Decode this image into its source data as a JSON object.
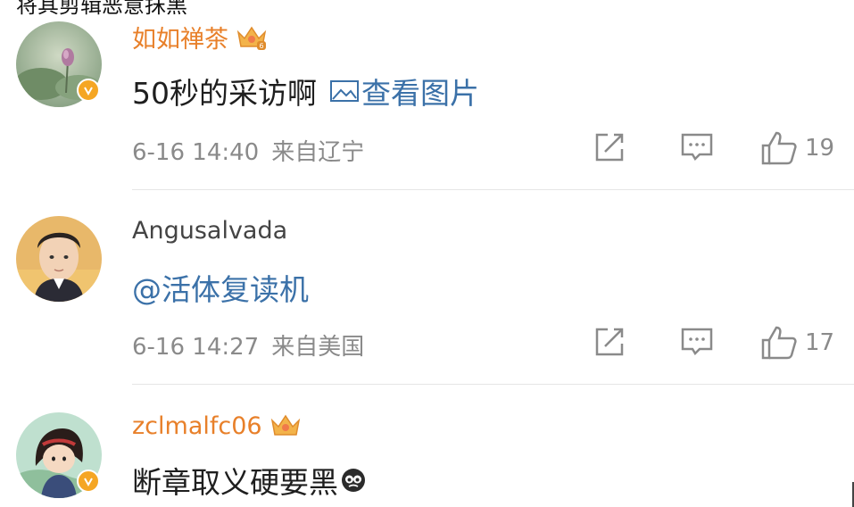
{
  "top_partial_text": "将其剪辑恶意抹黑",
  "comments": [
    {
      "username": "如如禅茶",
      "content": "50秒的采访啊",
      "view_image_label": "查看图片",
      "time": "6-16 14:40",
      "location": "来自辽宁",
      "likes": "19"
    },
    {
      "username": "Angusalvada",
      "content": "@活体复读机",
      "time": "6-16 14:27",
      "location": "来自美国",
      "likes": "17"
    },
    {
      "username": "zclmalfc06",
      "content": "断章取义硬要黑"
    }
  ],
  "colors": {
    "vip_name": "#e8802a",
    "link": "#3b71a8",
    "meta": "#8a8a8a",
    "verified_badge": "#f5a623"
  }
}
